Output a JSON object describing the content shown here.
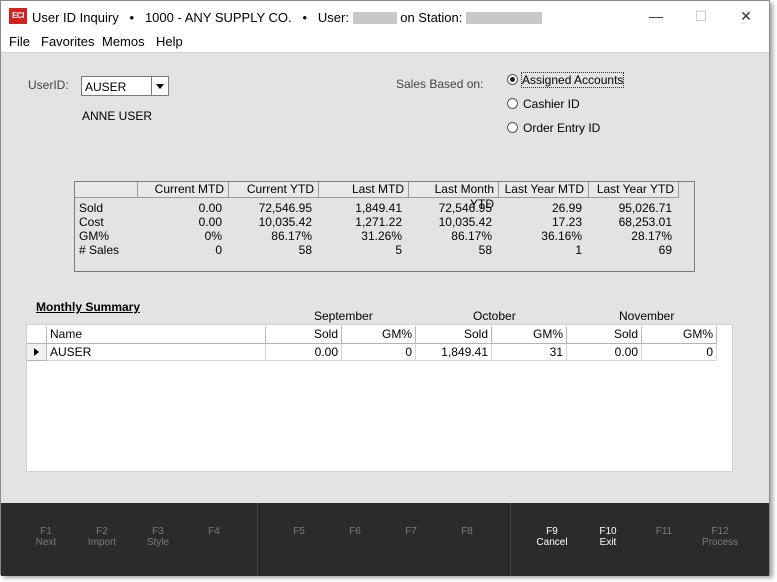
{
  "window": {
    "title_app": "User ID Inquiry",
    "title_bullet": "•",
    "title_company": "1000 - ANY SUPPLY CO.",
    "title_user_label": "User:",
    "title_station_label": "on Station:",
    "logo_text": "ECI",
    "minimize_glyph": "—",
    "maximize_glyph": "☐",
    "close_glyph": "✕"
  },
  "menu": [
    "File",
    "Favorites",
    "Memos",
    "Help"
  ],
  "form": {
    "userid_label": "UserID:",
    "userid_value": "AUSER",
    "user_name": "ANNE USER",
    "sales_based_label": "Sales Based on:",
    "options": [
      "Assigned Accounts",
      "Cashier ID",
      "Order Entry ID"
    ],
    "selected_option": "Assigned Accounts"
  },
  "stats": {
    "columns": [
      "",
      "Current MTD",
      "Current YTD",
      "Last MTD",
      "Last Month YTD",
      "Last Year MTD",
      "Last Year YTD"
    ],
    "rows": [
      {
        "label": "Sold",
        "values": [
          "0.00",
          "72,546.95",
          "1,849.41",
          "72,546.95",
          "26.99",
          "95,026.71"
        ]
      },
      {
        "label": "Cost",
        "values": [
          "0.00",
          "10,035.42",
          "1,271.22",
          "10,035.42",
          "17.23",
          "68,253.01"
        ]
      },
      {
        "label": "GM%",
        "values": [
          "0%",
          "86.17%",
          "31.26%",
          "86.17%",
          "36.16%",
          "28.17%"
        ]
      },
      {
        "label": "# Sales",
        "values": [
          "0",
          "58",
          "5",
          "58",
          "1",
          "69"
        ]
      }
    ]
  },
  "monthly": {
    "title": "Monthly Summary",
    "months": [
      "September",
      "October",
      "November"
    ],
    "columns": [
      "Name",
      "Sold",
      "GM%",
      "Sold",
      "GM%",
      "Sold",
      "GM%"
    ],
    "rows": [
      {
        "values": [
          "AUSER",
          "0.00",
          "0",
          "1,849.41",
          "31",
          "0.00",
          "0"
        ]
      }
    ]
  },
  "fkeys": [
    {
      "key": "F1",
      "label": "Next",
      "enabled": false
    },
    {
      "key": "F2",
      "label": "Import",
      "enabled": false
    },
    {
      "key": "F3",
      "label": "Style",
      "enabled": false
    },
    {
      "key": "F4",
      "label": "",
      "enabled": false
    },
    {
      "key": "F5",
      "label": "",
      "enabled": false
    },
    {
      "key": "F6",
      "label": "",
      "enabled": false
    },
    {
      "key": "F7",
      "label": "",
      "enabled": false
    },
    {
      "key": "F8",
      "label": "",
      "enabled": false
    },
    {
      "key": "F9",
      "label": "Cancel",
      "enabled": true
    },
    {
      "key": "F10",
      "label": "Exit",
      "enabled": true
    },
    {
      "key": "F11",
      "label": "",
      "enabled": false
    },
    {
      "key": "F12",
      "label": "Process",
      "enabled": false
    }
  ]
}
